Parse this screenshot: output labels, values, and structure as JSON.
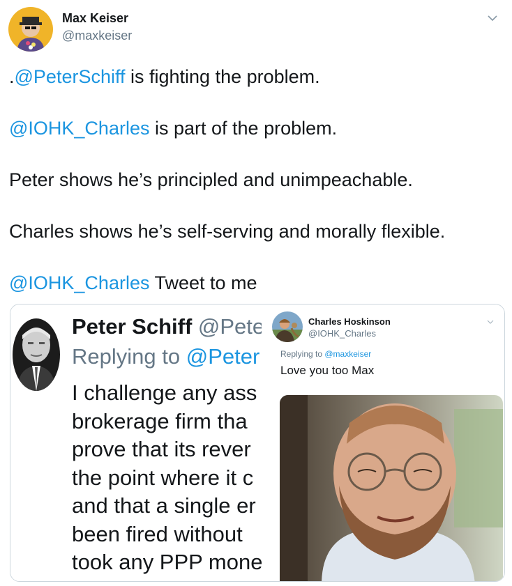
{
  "tweet": {
    "author_name": "Max Keiser",
    "author_handle": "@maxkeiser",
    "caret_icon": "chevron-down-icon",
    "paragraphs": [
      {
        "prefix": ".",
        "mention": "@PeterSchiff",
        "text": " is fighting the problem."
      },
      {
        "prefix": "",
        "mention": "@IOHK_Charles",
        "text": " is part of the problem."
      },
      {
        "prefix": "",
        "mention": "",
        "text": "Peter shows he’s principled and unimpeachable."
      },
      {
        "prefix": "",
        "mention": "",
        "text": "Charles shows he’s self-serving and morally flexible."
      },
      {
        "prefix": "",
        "mention": "@IOHK_Charles",
        "text": " Tweet to me"
      }
    ],
    "colors": {
      "link": "#1b95e0",
      "secondary": "#657786",
      "border": "#ccd6dd"
    }
  },
  "media": {
    "left": {
      "name": "Peter Schiff",
      "handle": "@Pete",
      "reply_label": "Replying to ",
      "reply_mention": "@Peter",
      "lines": [
        "I challenge any ass",
        "brokerage firm tha",
        "prove that its rever",
        "the point where it c",
        "and that a single er",
        "been fired without",
        "took any PPP mone"
      ]
    },
    "right": {
      "name": "Charles Hoskinson",
      "handle": "@IOHK_Charles",
      "reply_label": "Replying to ",
      "reply_mention": "@maxkeiser",
      "text": "Love you too Max",
      "caret_icon": "chevron-down-icon"
    }
  }
}
